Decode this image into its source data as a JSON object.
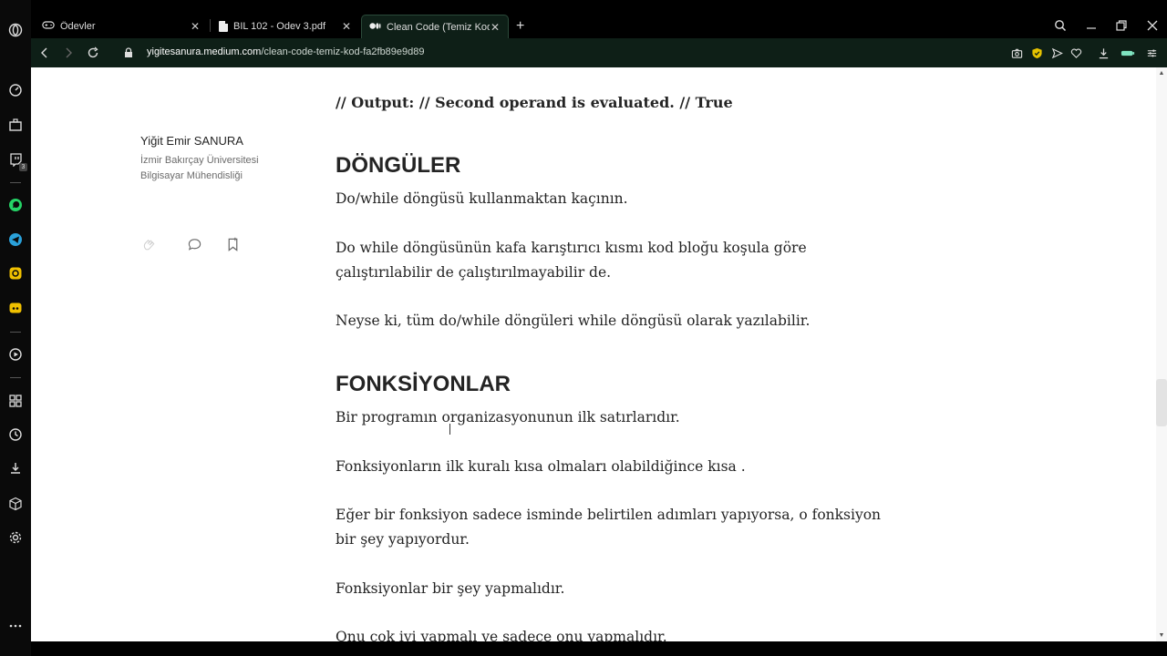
{
  "sidebar": {
    "icons": [
      "opera-logo-icon",
      "speed-dial-icon",
      "briefcase-icon",
      "twitch-icon",
      "whatsapp-icon",
      "telegram-icon",
      "instagram-icon",
      "discord-icon",
      "player-icon",
      "workspaces-icon",
      "history-icon",
      "downloads-icon",
      "extensions-icon",
      "settings-icon",
      "more-icon"
    ],
    "twitch_badge": "3"
  },
  "tabs": [
    {
      "label": "Ödevler",
      "icon": "game-controller-icon"
    },
    {
      "label": "BIL 102 - Odev 3.pdf",
      "icon": "document-icon"
    },
    {
      "label": "Clean Code (Temiz Kod). Te",
      "icon": "medium-icon",
      "active": true
    }
  ],
  "new_tab_label": "+",
  "close_label": "✕",
  "address": {
    "host": "yigitesanura.medium.com",
    "path": "/clean-code-temiz-kod-fa2fb89e9d89"
  },
  "author": {
    "name": "Yiğit Emir SANURA",
    "line1": "İzmir Bakırçay Üniversitesi",
    "line2": "Bilgisayar Mühendisliği"
  },
  "article": {
    "output_line": "// Output: // Second operand is evaluated. // True",
    "h_loops": "DÖNGÜLER",
    "p_loops_1": "Do/while döngüsü kullanmaktan kaçının.",
    "p_loops_2a": "Do while döngüsünün kafa karıştırıcı kısmı kod bloğu koşula göre",
    "p_loops_2b": "çalıştırılabilir de çalıştırılmayabilir de.",
    "p_loops_3": "Neyse ki, tüm do/while döngüleri while döngüsü olarak yazılabilir.",
    "h_functions": "FONKSİYONLAR",
    "p_fn_1": "Bir programın organizasyonunun ilk satırlarıdır.",
    "p_fn_2": "Fonksiyonların ilk kuralı kısa olmaları olabildiğince kısa .",
    "p_fn_3a": "Eğer bir fonksiyon sadece isminde belirtilen adımları yapıyorsa, o fonksiyon",
    "p_fn_3b": "bir şey yapıyordur.",
    "p_fn_4": "Fonksiyonlar bir şey yapmalıdır.",
    "p_fn_5": "Onu çok iyi yapmalı ve sadece onu yapmalıdır."
  },
  "colors": {
    "toolbar_bg": "#0e1f17",
    "accent": "#2ecc71",
    "text": "#242424"
  }
}
